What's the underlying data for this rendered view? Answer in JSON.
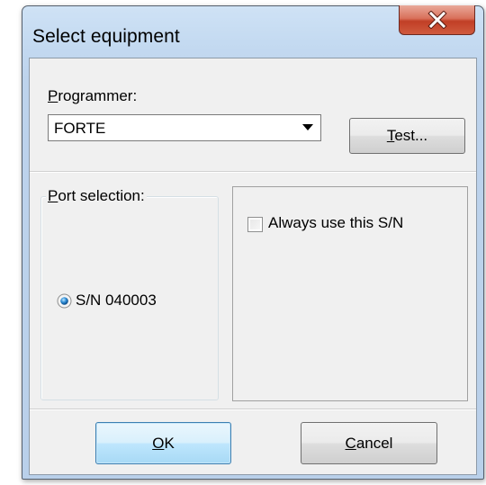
{
  "dialog": {
    "title": "Select equipment",
    "close_label": "X"
  },
  "programmer": {
    "label_accel": "P",
    "label_rest": "rogrammer:",
    "selected": "FORTE",
    "test_button_accel": "T",
    "test_button_rest": "est..."
  },
  "port_selection": {
    "label_accel": "P",
    "label_rest": "ort selection:",
    "option_label": "S/N 040003",
    "option_selected": true
  },
  "serial_options": {
    "always_use_label": "Always use this S/N",
    "always_use_checked": false
  },
  "buttons": {
    "ok_accel": "O",
    "ok_rest": "K",
    "cancel_accel": "C",
    "cancel_rest": "ancel"
  },
  "colors": {
    "close_button": "#c94a30",
    "window_frame": "#bdd3ec",
    "dialog_background": "#f0f0f0",
    "default_button_border": "#3c7fb1"
  },
  "icons": {
    "close": "close-icon",
    "dropdown": "chevron-down-icon",
    "radio": "radio-selected-icon"
  }
}
